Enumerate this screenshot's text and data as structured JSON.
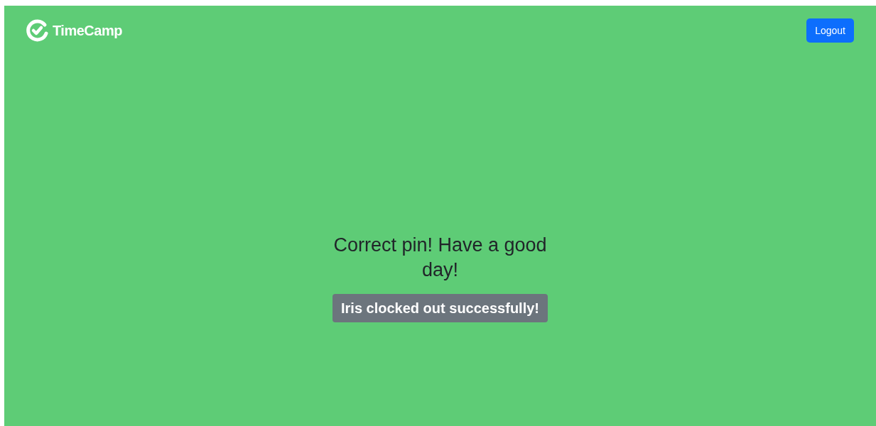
{
  "header": {
    "logo_text": "TimeCamp",
    "logout_button": "Logout"
  },
  "message": {
    "heading": "Correct pin! Have a good day!",
    "badge": "Iris clocked out successfully!"
  }
}
